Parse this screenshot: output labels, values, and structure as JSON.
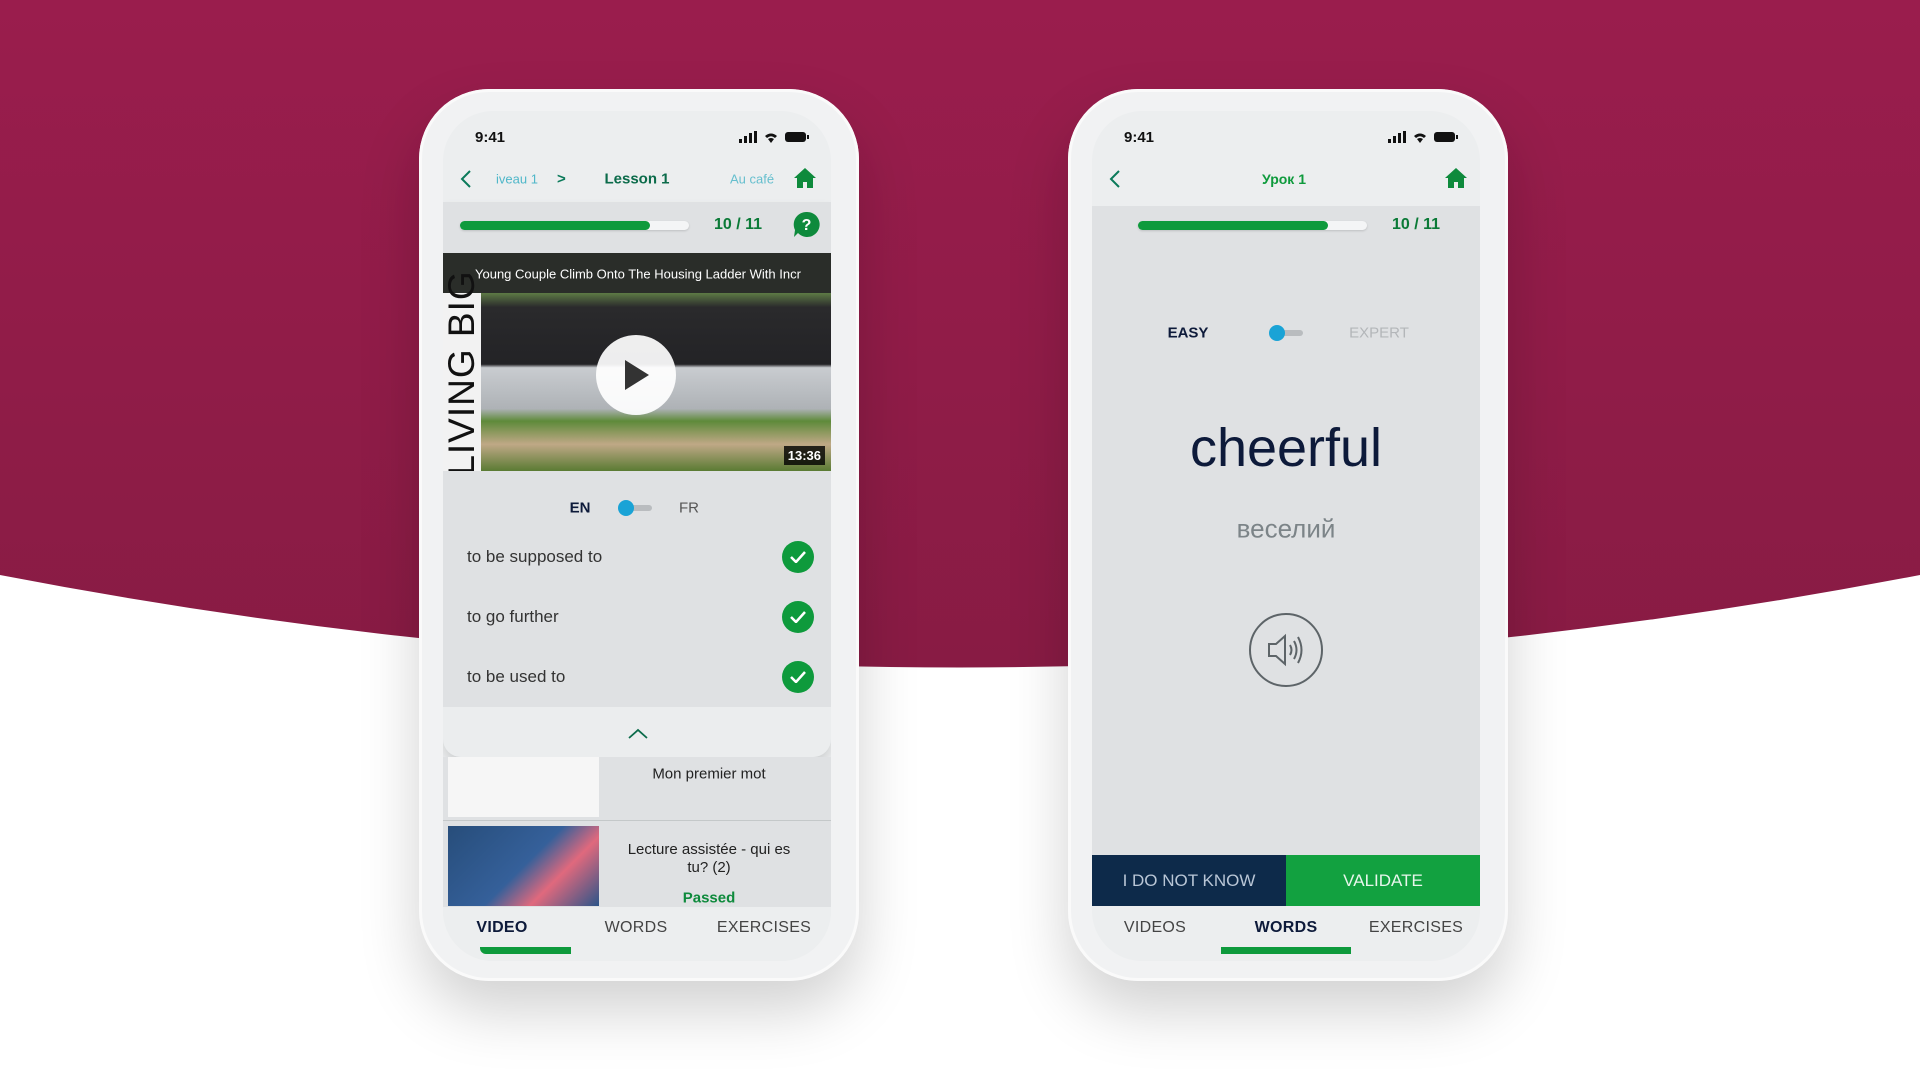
{
  "colors": {
    "background_top": "#9a1d4d",
    "accent_green": "#0e9a3c",
    "toggle_blue": "#1aa3d6",
    "navy": "#0d2a4a"
  },
  "left_phone": {
    "status_time": "9:41",
    "nav": {
      "back_icon": "chevron-left",
      "prev": "iveau 1",
      "sep": ">",
      "title": "Lesson 1",
      "next": "Au café",
      "home_icon": "home"
    },
    "progress": {
      "value": 10,
      "total": 11,
      "label": "10 / 11",
      "help_icon": "question-bubble"
    },
    "video": {
      "title": "Young Couple Climb Onto The Housing Ladder With Incr",
      "channel": "LIVING BIG",
      "duration": "13:36",
      "play_icon": "play"
    },
    "lang_toggle": {
      "left": "EN",
      "right": "FR"
    },
    "words": [
      {
        "text": "to be supposed to",
        "done": true
      },
      {
        "text": "to go further",
        "done": true
      },
      {
        "text": "to be used to",
        "done": true
      }
    ],
    "collapse_icon": "chevron-up",
    "lessons": [
      {
        "title": "Mon premier mot",
        "status": ""
      },
      {
        "title": "Lecture assistée - qui es tu? (2)",
        "status": "Passed"
      }
    ],
    "tabs": [
      {
        "label": "VIDEO",
        "active": true
      },
      {
        "label": "WORDS",
        "active": false
      },
      {
        "label": "EXERCISES",
        "active": false
      }
    ]
  },
  "right_phone": {
    "status_time": "9:41",
    "nav": {
      "back_icon": "chevron-left",
      "title": "Урок 1",
      "home_icon": "home"
    },
    "progress": {
      "value": 10,
      "total": 11,
      "label": "10 / 11"
    },
    "level_toggle": {
      "left": "EASY",
      "right": "EXPERT"
    },
    "word": "cheerful",
    "translation": "веселий",
    "speaker_icon": "speaker",
    "buttons": {
      "dont_know": "I DO NOT KNOW",
      "validate": "VALIDATE"
    },
    "tabs": [
      {
        "label": "VIDEOS",
        "active": false
      },
      {
        "label": "WORDS",
        "active": true
      },
      {
        "label": "EXERCISES",
        "active": false
      }
    ]
  }
}
